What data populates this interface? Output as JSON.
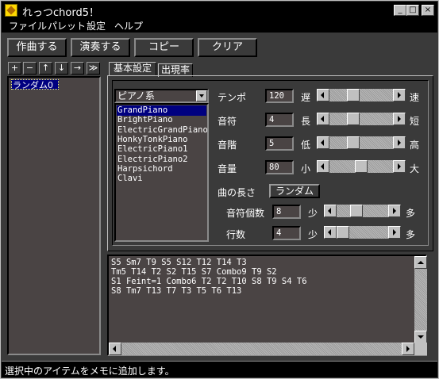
{
  "window": {
    "title": "れっつchord5！",
    "min_label": "_",
    "max_label": "□",
    "close_label": "×"
  },
  "menu": [
    "ファイル",
    "パレット",
    "設定",
    "ヘルプ"
  ],
  "toolbar": {
    "compose": "作曲する",
    "play": "演奏する",
    "copy": "コピー",
    "clear": "クリア"
  },
  "memo_tools": [
    "+",
    "−",
    "↑",
    "↓",
    "→",
    "≫"
  ],
  "memo_list": {
    "items": [
      "ランダム0"
    ]
  },
  "tabs": {
    "basic": "基本設定",
    "frequency": "出現率"
  },
  "instrument": {
    "category": "ピアノ系",
    "options": [
      "GrandPiano",
      "BrightPiano",
      "ElectricGrandPiano",
      "HonkyTonkPiano",
      "ElectricPiano1",
      "ElectricPiano2",
      "Harpsichord",
      "Clavi"
    ],
    "selected_index": 0
  },
  "settings": {
    "tempo": {
      "label": "テンポ",
      "value": "120",
      "min_label": "遅",
      "max_label": "速",
      "level": 0.35
    },
    "note": {
      "label": "音符",
      "value": "4",
      "min_label": "長",
      "max_label": "短",
      "level": 0.35
    },
    "scale": {
      "label": "音階",
      "value": "5",
      "min_label": "低",
      "max_label": "高",
      "level": 0.35
    },
    "volume": {
      "label": "音量",
      "value": "80",
      "min_label": "小",
      "max_label": "大",
      "level": 0.5
    }
  },
  "length": {
    "label": "曲の長さ",
    "random_button": "ランダム",
    "note_count": {
      "label": "音符個数",
      "value": "8",
      "min_label": "少",
      "max_label": "多",
      "level": 0.35
    },
    "rows": {
      "label": "行数",
      "value": "4",
      "min_label": "少",
      "max_label": "多",
      "level": 0.0
    }
  },
  "memo_text": [
    "S5 Sm7 T9 S5 S12 T12 T14 T3",
    "Tm5 T14 T2 S2 T15 S7 Combo9 T9 S2",
    "S1 Feint=1 Combo6 T2 T2 T10 S8 T9 S4 T6",
    "S8 Tm7 T13 T7 T3 T5 T6 T13"
  ],
  "status": "選択中のアイテムをメモに追加します。"
}
